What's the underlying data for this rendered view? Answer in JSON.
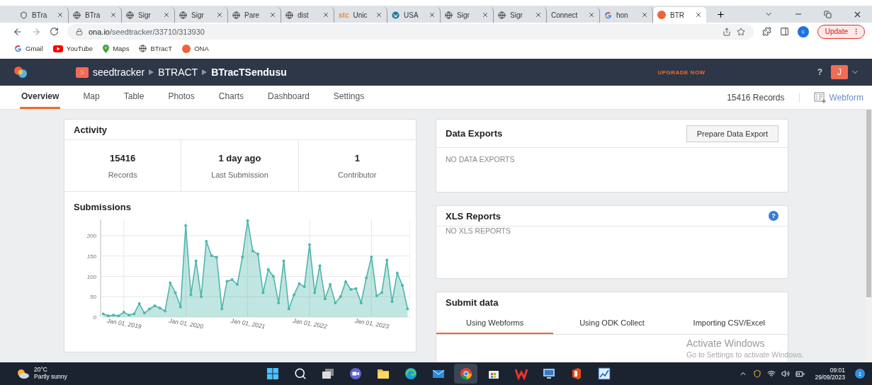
{
  "browser": {
    "tabs": [
      {
        "title": "BTra",
        "kind": "shield",
        "selected": false
      },
      {
        "title": "BTra",
        "kind": "globe",
        "selected": false
      },
      {
        "title": "Sigr",
        "kind": "globe",
        "selected": false
      },
      {
        "title": "Sigr",
        "kind": "globe",
        "selected": false
      },
      {
        "title": "Pare",
        "kind": "globe",
        "selected": false
      },
      {
        "title": "dist",
        "kind": "globe",
        "selected": false
      },
      {
        "title": "Unic",
        "kind": "text",
        "favicon_text": "stc",
        "selected": false
      },
      {
        "title": "USA",
        "kind": "wordpress",
        "selected": false
      },
      {
        "title": "Sigr",
        "kind": "globe",
        "selected": false
      },
      {
        "title": "Sigr",
        "kind": "globe",
        "selected": false
      },
      {
        "title": "Connect",
        "kind": "plain",
        "selected": false
      },
      {
        "title": "hon",
        "kind": "google",
        "selected": false
      },
      {
        "title": "BTR",
        "kind": "ona",
        "selected": true
      }
    ],
    "url": {
      "domain": "ona.io",
      "path": "/seedtracker/33710/313930"
    },
    "profile": "c",
    "update_button": "Update",
    "bookmarks": [
      {
        "label": "Gmail",
        "kind": "google"
      },
      {
        "label": "YouTube",
        "kind": "youtube"
      },
      {
        "label": "Maps",
        "kind": "maps"
      },
      {
        "label": "BTracT",
        "kind": "globe"
      },
      {
        "label": "ONA",
        "kind": "ona"
      }
    ]
  },
  "app": {
    "breadcrumb": {
      "badge": "S",
      "items": [
        "seedtracker",
        "BTRACT",
        "BTracTSendusu"
      ]
    },
    "upgrade": "UPGRADE NOW",
    "help": "?",
    "avatar": "J",
    "nav": [
      {
        "label": "Overview",
        "selected": true
      },
      {
        "label": "Map",
        "selected": false
      },
      {
        "label": "Table",
        "selected": false
      },
      {
        "label": "Photos",
        "selected": false
      },
      {
        "label": "Charts",
        "selected": false
      },
      {
        "label": "Dashboard",
        "selected": false
      },
      {
        "label": "Settings",
        "selected": false
      }
    ],
    "records": "15416 Records",
    "webform": "Webform"
  },
  "activity": {
    "title": "Activity",
    "stats": [
      {
        "value": "15416",
        "label": "Records"
      },
      {
        "value": "1 day ago",
        "label": "Last Submission"
      },
      {
        "value": "1",
        "label": "Contributor"
      }
    ]
  },
  "submissions": {
    "title": "Submissions",
    "chart_data": {
      "type": "area",
      "grid": true,
      "categories": [
        null,
        null,
        null,
        null,
        "Jan 01, 2019",
        null,
        null,
        null,
        null,
        null,
        null,
        null,
        null,
        null,
        null,
        null,
        "Jan 01, 2020",
        null,
        null,
        null,
        null,
        null,
        null,
        null,
        null,
        null,
        null,
        null,
        "Jan 01, 2021",
        null,
        null,
        null,
        null,
        null,
        null,
        null,
        null,
        null,
        null,
        null,
        "Jan 01, 2022",
        null,
        null,
        null,
        null,
        null,
        null,
        null,
        null,
        null,
        null,
        null,
        "Jan 01, 2023",
        null,
        null,
        null,
        null,
        null,
        null,
        null
      ],
      "series": [
        {
          "color": "#4db6ac",
          "values": [
            8,
            3,
            5,
            3,
            12,
            5,
            8,
            33,
            10,
            20,
            28,
            22,
            15,
            84,
            60,
            25,
            225,
            55,
            138,
            50,
            186,
            151,
            147,
            20,
            88,
            92,
            80,
            148,
            237,
            162,
            155,
            60,
            117,
            100,
            35,
            138,
            20,
            55,
            82,
            75,
            178,
            60,
            126,
            45,
            80,
            35,
            50,
            87,
            68,
            70,
            35,
            96,
            148,
            52,
            60,
            140,
            38,
            108,
            78,
            20
          ]
        }
      ],
      "ylim": [
        0,
        240
      ],
      "yticks": [
        0,
        50,
        100,
        150,
        200
      ]
    }
  },
  "data_exports": {
    "title": "Data Exports",
    "button": "Prepare Data Export",
    "empty": "NO DATA EXPORTS"
  },
  "xls_reports": {
    "title": "XLS Reports",
    "help": "?",
    "empty": "NO XLS REPORTS"
  },
  "submit_data": {
    "title": "Submit data",
    "tabs": [
      {
        "label": "Using Webforms",
        "selected": true
      },
      {
        "label": "Using ODK Collect",
        "selected": false
      },
      {
        "label": "Importing CSV/Excel",
        "selected": false
      }
    ]
  },
  "activation": {
    "title": "Activate Windows",
    "subtitle": "Go to Settings to activate Windows."
  },
  "taskbar": {
    "weather": {
      "temp": "20°C",
      "text": "Partly sunny"
    },
    "apps": [
      {
        "kind": "start",
        "selected": false
      },
      {
        "kind": "search",
        "selected": false
      },
      {
        "kind": "taskview",
        "selected": false
      },
      {
        "kind": "meet",
        "selected": false
      },
      {
        "kind": "files",
        "selected": false
      },
      {
        "kind": "edge",
        "selected": false
      },
      {
        "kind": "mail",
        "selected": false
      },
      {
        "kind": "chrome",
        "selected": true
      },
      {
        "kind": "store",
        "selected": false
      },
      {
        "kind": "wps",
        "selected": false
      },
      {
        "kind": "monitor",
        "selected": false
      },
      {
        "kind": "office",
        "selected": false
      },
      {
        "kind": "chart",
        "selected": false
      }
    ],
    "time": "09:01",
    "date": "29/09/2023",
    "notifications": "1"
  }
}
